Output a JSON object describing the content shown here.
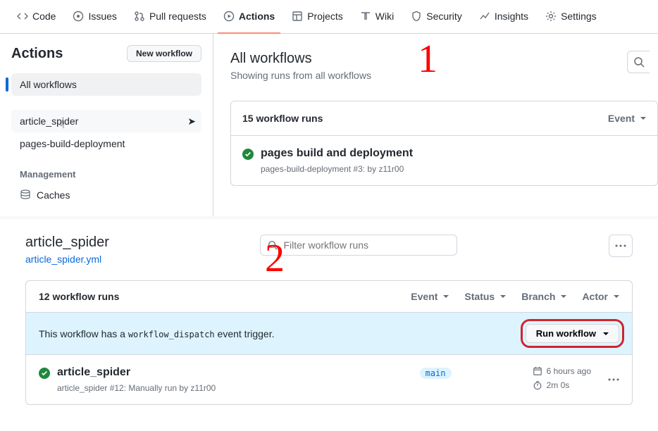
{
  "tabs": [
    {
      "label": "Code",
      "icon": "code"
    },
    {
      "label": "Issues",
      "icon": "issue"
    },
    {
      "label": "Pull requests",
      "icon": "pr"
    },
    {
      "label": "Actions",
      "icon": "play",
      "selected": true
    },
    {
      "label": "Projects",
      "icon": "project"
    },
    {
      "label": "Wiki",
      "icon": "book"
    },
    {
      "label": "Security",
      "icon": "shield"
    },
    {
      "label": "Insights",
      "icon": "graph"
    },
    {
      "label": "Settings",
      "icon": "gear"
    }
  ],
  "sidebar": {
    "title": "Actions",
    "new_workflow": "New workflow",
    "all_workflows": "All workflows",
    "workflows": [
      {
        "label": "article_spider"
      },
      {
        "label": "pages-build-deployment"
      }
    ],
    "management_heading": "Management",
    "caches": "Caches"
  },
  "panel1": {
    "title": "All workflows",
    "subtitle": "Showing runs from all workflows",
    "runs_count": "15 workflow runs",
    "event_filter": "Event",
    "run": {
      "title": "pages build and deployment",
      "meta": "pages-build-deployment #3: by z11r00"
    },
    "annotation": "1"
  },
  "panel2": {
    "title": "article_spider",
    "yml": "article_spider.yml",
    "filter_placeholder": "Filter workflow runs",
    "runs_count": "12 workflow runs",
    "filters": [
      "Event",
      "Status",
      "Branch",
      "Actor"
    ],
    "dispatch_pre": "This workflow has a ",
    "dispatch_code": "workflow_dispatch",
    "dispatch_post": " event trigger.",
    "run_workflow": "Run workflow",
    "row": {
      "title": "article_spider",
      "meta": "article_spider #12: Manually run by z11r00",
      "branch": "main",
      "time": "6 hours ago",
      "duration": "2m 0s"
    },
    "annotation": "2"
  }
}
